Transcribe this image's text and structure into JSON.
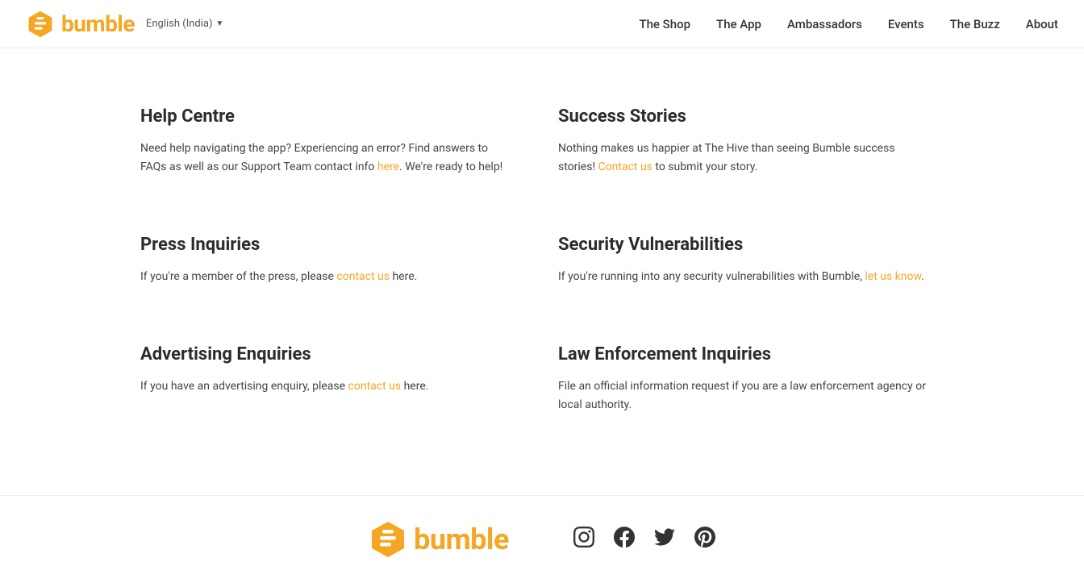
{
  "header": {
    "logo_text": "bumble",
    "lang_label": "English (India)",
    "nav": [
      {
        "label": "The Shop",
        "href": "#"
      },
      {
        "label": "The App",
        "href": "#"
      },
      {
        "label": "Ambassadors",
        "href": "#"
      },
      {
        "label": "Events",
        "href": "#"
      },
      {
        "label": "The Buzz",
        "href": "#"
      },
      {
        "label": "About",
        "href": "#"
      }
    ]
  },
  "cards": [
    {
      "title": "Help Centre",
      "body_plain": "Need help navigating the app? Experiencing an error? Find answers to FAQs as well as our Support Team contact info ",
      "link1_text": "here",
      "body_mid": ". We're ready to help!",
      "link2_text": null
    },
    {
      "title": "Success Stories",
      "body_plain": "Nothing makes us happier at The Hive than seeing Bumble success stories! ",
      "link1_text": "Contact us",
      "body_mid": " to submit your story.",
      "link2_text": null
    },
    {
      "title": "Press Inquiries",
      "body_plain": "If you're a member of the press, please ",
      "link1_text": "contact us",
      "body_mid": " here.",
      "link2_text": null
    },
    {
      "title": "Security Vulnerabilities",
      "body_plain": "If you're running into any security vulnerabilities with Bumble, ",
      "link1_text": "let us know",
      "body_mid": ".",
      "link2_text": null
    },
    {
      "title": "Advertising Enquiries",
      "body_plain": "If you have an advertising enquiry, please ",
      "link1_text": "contact us",
      "body_mid": " here.",
      "link2_text": null
    },
    {
      "title": "Law Enforcement Inquiries",
      "body_plain": "File an official information request if you are a law enforcement agency or local authority.",
      "link1_text": null,
      "body_mid": null,
      "link2_text": null
    }
  ],
  "footer": {
    "logo_text": "bumble",
    "social": [
      {
        "name": "instagram",
        "label": "Instagram"
      },
      {
        "name": "facebook",
        "label": "Facebook"
      },
      {
        "name": "twitter",
        "label": "Twitter"
      },
      {
        "name": "pinterest",
        "label": "Pinterest"
      }
    ]
  }
}
